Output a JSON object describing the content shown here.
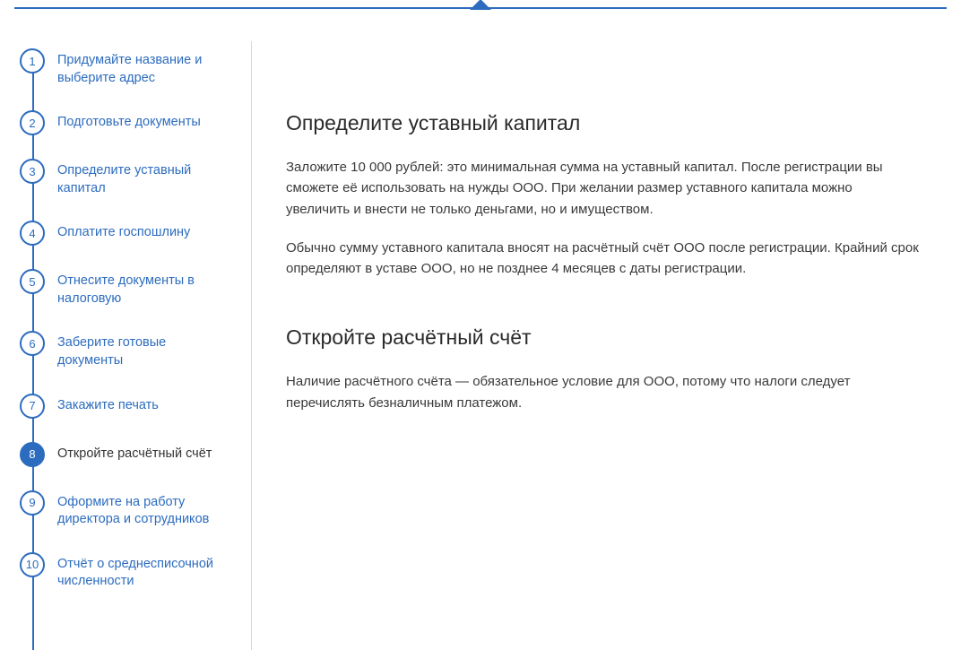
{
  "sidebar": {
    "steps": [
      {
        "num": "1",
        "label": "Придумайте название и выберите адрес"
      },
      {
        "num": "2",
        "label": "Подготовьте документы"
      },
      {
        "num": "3",
        "label": "Определите уставный капитал"
      },
      {
        "num": "4",
        "label": "Оплатите госпошлину"
      },
      {
        "num": "5",
        "label": "Отнесите документы в налоговую"
      },
      {
        "num": "6",
        "label": "Заберите готовые документы"
      },
      {
        "num": "7",
        "label": "Закажите печать"
      },
      {
        "num": "8",
        "label": "Откройте расчётный счёт"
      },
      {
        "num": "9",
        "label": "Оформите на работу директора и сотрудников"
      },
      {
        "num": "10",
        "label": "Отчёт о среднесписочной численности"
      }
    ],
    "activeIndex": 7
  },
  "content": {
    "section1": {
      "heading": "Определите уставный капитал",
      "p1": "Заложите 10 000 рублей: это минимальная сумма на уставный капитал. После регистрации вы сможете её использовать на нужды ООО. При желании размер уставного капитала можно увеличить и внести не только деньгами, но и имуществом.",
      "p2": "Обычно сумму уставного капитала вносят на расчётный счёт ООО после регистрации. Крайний срок определяют в уставе ООО, но не позднее 4 месяцев с даты регистрации."
    },
    "section2": {
      "heading": "Откройте расчётный счёт",
      "p1": "Наличие расчётного счёта — обязательное условие для ООО, потому что налоги следует перечислять безналичным платежом."
    }
  }
}
